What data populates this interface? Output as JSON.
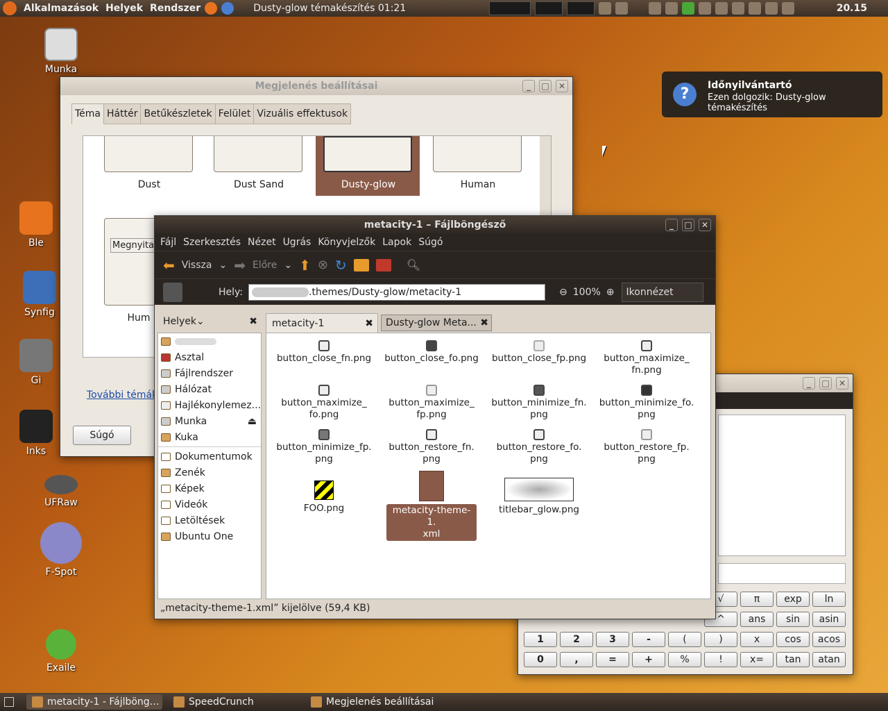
{
  "top_panel": {
    "menu_apps": "Alkalmazások",
    "menu_places": "Helyek",
    "menu_system": "Rendszer",
    "timer": "Dusty-glow témakészítés 01:21",
    "clock": "20.15"
  },
  "desktop_icons": [
    "Munka",
    "Ble",
    "Synfig",
    "Gi",
    "Inks",
    "UFRaw",
    "F-Spot",
    "Exaile"
  ],
  "appearance_window": {
    "title": "Megjelenés beállításai",
    "tabs": [
      "Téma",
      "Háttér",
      "Betűkészletek",
      "Felület",
      "Vizuális effektusok"
    ],
    "themes": [
      "Dust",
      "Dust Sand",
      "Dusty-glow",
      "Human"
    ],
    "partial_theme": "Hum",
    "more_themes_link": "További témák",
    "help_button": "Súgó",
    "open_partial": "Megnyita"
  },
  "notification": {
    "title": "Időnyilvántartó",
    "body": "Ezen dolgozik: Dusty-glow témakészítés"
  },
  "file_browser": {
    "title": "metacity-1 – Fájlböngésző",
    "menu": [
      "Fájl",
      "Szerkesztés",
      "Nézet",
      "Ugrás",
      "Könyvjelzők",
      "Lapok",
      "Súgó"
    ],
    "toolbar": {
      "back": "Vissza",
      "forward": "Előre"
    },
    "location_label": "Hely:",
    "location_path": ".themes/Dusty-glow/metacity-1",
    "zoom": "100%",
    "view_mode": "Ikonnézet",
    "sidebar_title": "Helyek",
    "sidebar_items": [
      "Asztal",
      "Fájlrendszer",
      "Hálózat",
      "Hajlékonylemez...",
      "Munka",
      "Kuka"
    ],
    "bookmarks": [
      "Dokumentumok",
      "Zenék",
      "Képek",
      "Videók",
      "Letöltések",
      "Ubuntu One"
    ],
    "tabs": [
      "metacity-1",
      "Dusty-glow Meta..."
    ],
    "files": [
      [
        "button_close_fn.png"
      ],
      [
        "button_close_fo.png"
      ],
      [
        "button_close_fp.png"
      ],
      [
        "button_maximize_",
        "fn.png"
      ],
      [
        "button_maximize_",
        "fo.png"
      ],
      [
        "button_maximize_",
        "fp.png"
      ],
      [
        "button_minimize_fn.",
        "png"
      ],
      [
        "button_minimize_fo.",
        "png"
      ],
      [
        "button_minimize_fp.",
        "png"
      ],
      [
        "button_restore_fn.",
        "png"
      ],
      [
        "button_restore_fo.",
        "png"
      ],
      [
        "button_restore_fp.",
        "png"
      ],
      [
        "FOO.png"
      ],
      [
        "metacity-theme-1.",
        "xml"
      ],
      [
        "titlebar_glow.png"
      ]
    ],
    "status": "„metacity-theme-1.xml” kijelölve (59,4 KB)"
  },
  "speedcrunch": {
    "buttons_row1": [
      "√",
      "π",
      "exp",
      "ln"
    ],
    "buttons_row2": [
      "^",
      "ans",
      "sin",
      "asin"
    ],
    "buttons_row3": [
      "1",
      "2",
      "3",
      "-",
      "(",
      ")",
      "x",
      "cos",
      "acos"
    ],
    "buttons_row4": [
      "0",
      ",",
      "=",
      "+",
      "%",
      "!",
      "x=",
      "tan",
      "atan"
    ]
  },
  "taskbar": [
    "metacity-1 - Fájlböng...",
    "SpeedCrunch",
    "Megjelenés beállításai"
  ]
}
